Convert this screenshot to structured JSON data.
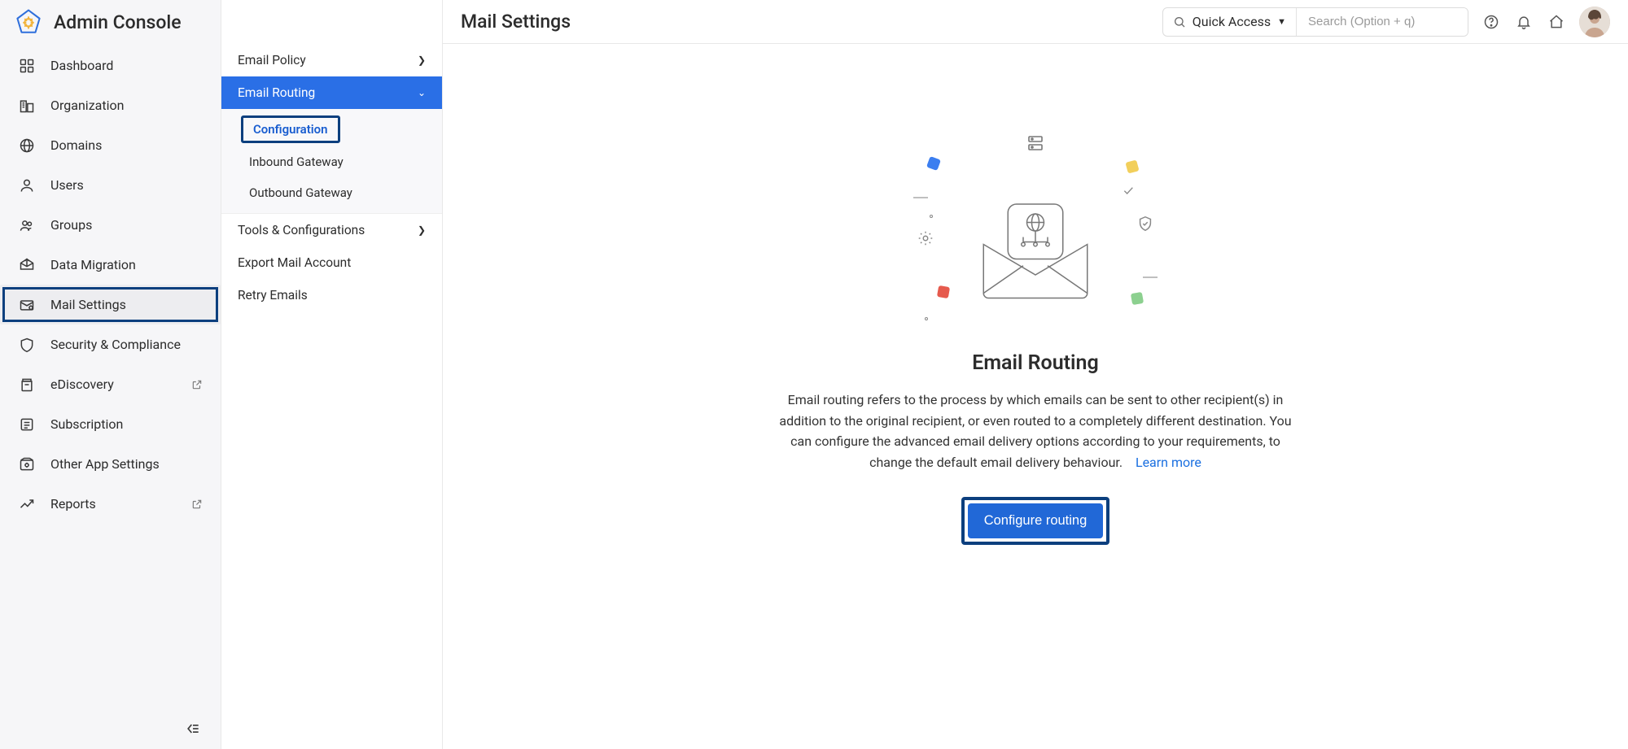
{
  "app_title": "Admin Console",
  "page_title": "Mail Settings",
  "search": {
    "quick_access_label": "Quick Access",
    "placeholder": "Search (Option + q)"
  },
  "sidebar": {
    "items": [
      {
        "label": "Dashboard"
      },
      {
        "label": "Organization"
      },
      {
        "label": "Domains"
      },
      {
        "label": "Users"
      },
      {
        "label": "Groups"
      },
      {
        "label": "Data Migration"
      },
      {
        "label": "Mail Settings"
      },
      {
        "label": "Security & Compliance"
      },
      {
        "label": "eDiscovery"
      },
      {
        "label": "Subscription"
      },
      {
        "label": "Other App Settings"
      },
      {
        "label": "Reports"
      }
    ]
  },
  "subnav": {
    "email_policy": "Email Policy",
    "email_routing": "Email Routing",
    "configuration": "Configuration",
    "inbound_gateway": "Inbound Gateway",
    "outbound_gateway": "Outbound Gateway",
    "tools_config": "Tools & Configurations",
    "export_mail": "Export Mail Account",
    "retry_emails": "Retry Emails"
  },
  "content": {
    "heading": "Email Routing",
    "description": "Email routing refers to the process by which emails can be sent to other recipient(s) in addition to the original recipient, or even routed to a completely different destination. You can configure the advanced email delivery options according to your requirements, to change the default email delivery behaviour.",
    "learn_more": "Learn more",
    "cta": "Configure routing"
  }
}
